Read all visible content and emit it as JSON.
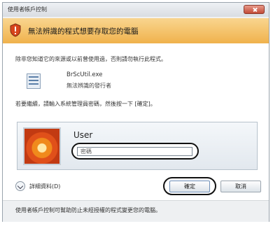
{
  "window": {
    "title": "使用者帳戶控制"
  },
  "banner": {
    "message": "無法辨識的程式想要存取您的電腦",
    "icon": "shield-warning-icon"
  },
  "body": {
    "intro": "除非您知道它的來源或以前曾使用過，否則請勿執行此程式。",
    "program": {
      "name": "BrScUtil.exe",
      "publisher": "無法辨識的發行者",
      "icon": "program-icon"
    },
    "instruction": "若要繼續，請輸入系統管理員密碼，然後按一下 [確定]。"
  },
  "credential": {
    "user_name": "User",
    "password_placeholder": "密碼",
    "avatar_icon": "flower-avatar-icon"
  },
  "actions": {
    "details_label": "詳細資料(D)",
    "ok_label": "確定",
    "cancel_label": "取消"
  },
  "footer": {
    "text": "使用者帳戶控制可幫助防止未經授權的程式變更您的電腦。"
  },
  "colors": {
    "banner_top": "#f9d58f",
    "banner_bottom": "#f0b24c",
    "close_red": "#c24a37"
  }
}
